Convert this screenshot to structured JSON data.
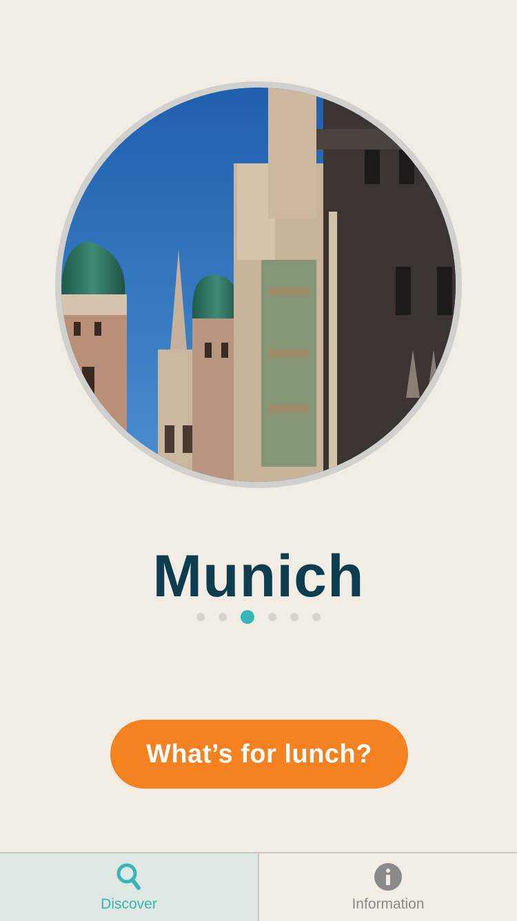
{
  "hero": {
    "image_alt": "Munich city hall and Frauenkirche towers"
  },
  "city": {
    "name": "Munich"
  },
  "pager": {
    "count": 6,
    "active_index": 2
  },
  "cta": {
    "label": "What’s for lunch?"
  },
  "tabbar": {
    "tabs": [
      {
        "label": "Discover",
        "icon": "search-icon",
        "active": true
      },
      {
        "label": "Information",
        "icon": "info-icon",
        "active": false
      }
    ]
  },
  "colors": {
    "background": "#f2ede4",
    "title": "#0d3d4f",
    "accent": "#35b7b5",
    "cta": "#f58220",
    "inactive": "#8a8a8a"
  }
}
